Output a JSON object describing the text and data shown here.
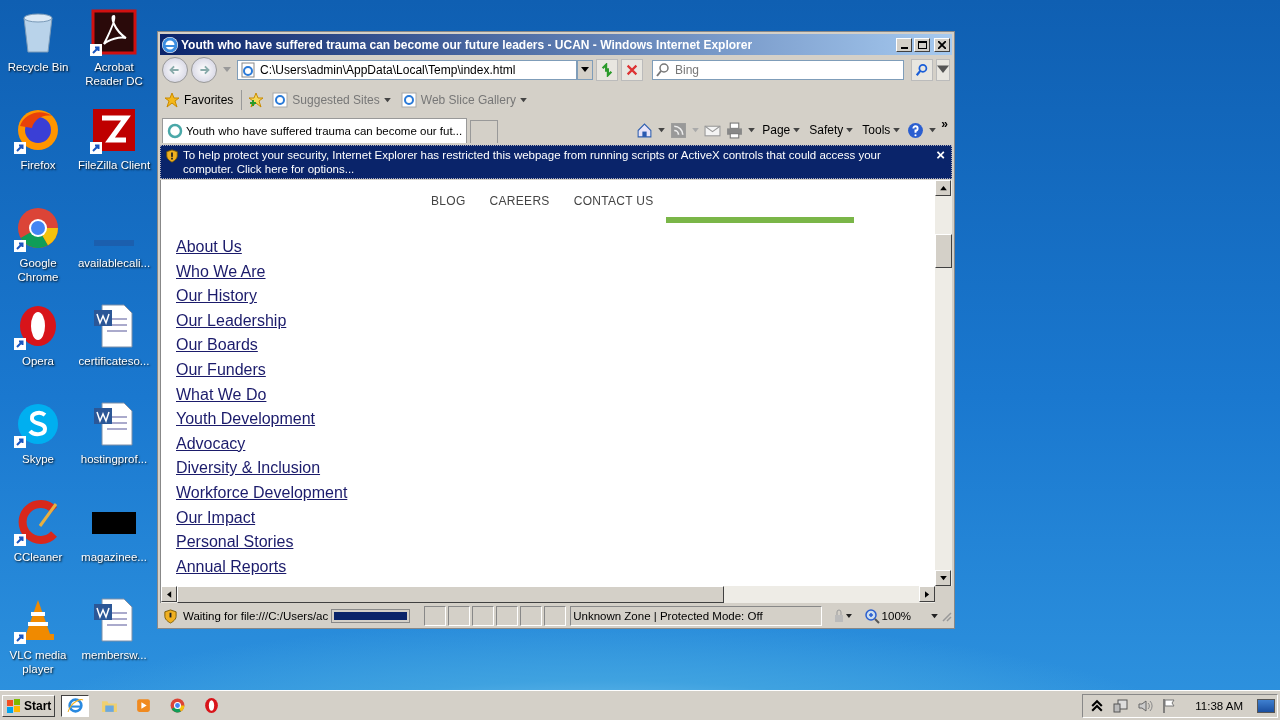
{
  "desktop_icons": [
    {
      "label": "Recycle Bin",
      "kind": "recycle",
      "shortcut": false
    },
    {
      "label": "Acrobat Reader DC",
      "kind": "acrobat",
      "shortcut": true
    },
    {
      "label": "Firefox",
      "kind": "firefox",
      "shortcut": true
    },
    {
      "label": "FileZilla Client",
      "kind": "filezilla",
      "shortcut": true
    },
    {
      "label": "Google Chrome",
      "kind": "chrome",
      "shortcut": true
    },
    {
      "label": "availablecali...",
      "kind": "blank",
      "shortcut": false
    },
    {
      "label": "Opera",
      "kind": "opera",
      "shortcut": true
    },
    {
      "label": "certificateso...",
      "kind": "word",
      "shortcut": false
    },
    {
      "label": "Skype",
      "kind": "skype",
      "shortcut": true
    },
    {
      "label": "hostingprof...",
      "kind": "word",
      "shortcut": false
    },
    {
      "label": "CCleaner",
      "kind": "ccleaner",
      "shortcut": true
    },
    {
      "label": "magazinee...",
      "kind": "black",
      "shortcut": false
    },
    {
      "label": "VLC media player",
      "kind": "vlc",
      "shortcut": true
    },
    {
      "label": "membersw...",
      "kind": "word",
      "shortcut": false
    }
  ],
  "browser": {
    "title": "Youth who have suffered trauma can become our future leaders - UCAN - Windows Internet Explorer",
    "address": "C:\\Users\\admin\\AppData\\Local\\Temp\\index.html",
    "search": {
      "placeholder": "Bing"
    },
    "favorites": "Favorites",
    "favorites_links": [
      "Suggested Sites",
      "Web Slice Gallery"
    ],
    "tabs": [
      {
        "label": "Youth who have suffered trauma can become our fut...",
        "selected": true
      }
    ],
    "command_menus": [
      "Page",
      "Safety",
      "Tools"
    ],
    "more": "»",
    "infobar": {
      "text": "To help protect your security, Internet Explorer has restricted this webpage from running scripts or ActiveX controls that could access your computer. Click here for options...",
      "close": "×"
    },
    "page": {
      "nav": [
        "BLOG",
        "CAREERS",
        "CONTACT US"
      ],
      "links": [
        "About Us",
        "Who We Are",
        "Our History",
        "Our Leadership",
        "Our Boards",
        "Our Funders",
        "What We Do",
        "Youth Development",
        "Advocacy",
        "Diversity & Inclusion",
        "Workforce Development",
        "Our Impact",
        "Personal Stories",
        "Annual Reports"
      ]
    },
    "status": {
      "text": "Waiting for file:///C:/Users/ac",
      "progress": {
        "level": 1
      },
      "zone": "Unknown Zone | Protected Mode: Off",
      "zoom": "100%"
    }
  },
  "taskbar": {
    "start": "Start",
    "apps": [
      {
        "kind": "ie",
        "selected": true
      },
      {
        "kind": "folder",
        "selected": false
      },
      {
        "kind": "media",
        "selected": false
      },
      {
        "kind": "chrome",
        "selected": false
      },
      {
        "kind": "opera",
        "selected": false
      }
    ],
    "clock": "11:38 AM"
  }
}
